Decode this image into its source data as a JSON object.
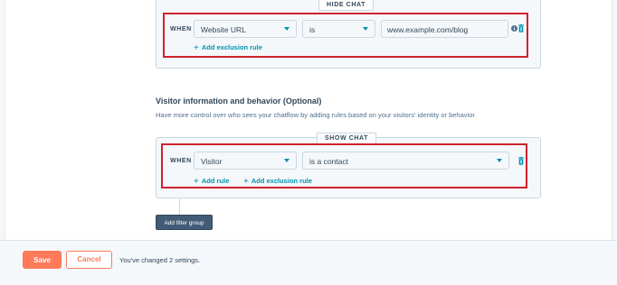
{
  "exclusion_section": {
    "divider_label": "HIDE CHAT",
    "when_label": "WHEN",
    "property_select": "Website URL",
    "operator_select": "is",
    "value_input": "www.example.com/blog",
    "add_exclusion_label": "Add exclusion rule"
  },
  "visitor_section": {
    "title": "Visitor information and behavior (Optional)",
    "description": "Have more control over who sees your chatflow by adding rules based on your visitors' identity or behavior",
    "divider_label": "SHOW CHAT",
    "when_label": "WHEN",
    "property_select": "Visitor",
    "operator_select": "is a contact",
    "add_rule_label": "Add rule",
    "add_exclusion_label": "Add exclusion rule",
    "add_filter_group_label": "Add filter group"
  },
  "footer": {
    "save_label": "Save",
    "cancel_label": "Cancel",
    "status_message": "You've changed 2 settings."
  },
  "colors": {
    "accent": "#0091ae",
    "primary_button": "#ff7a59",
    "highlight_border": "#d0212d",
    "dark_button": "#425b76"
  }
}
